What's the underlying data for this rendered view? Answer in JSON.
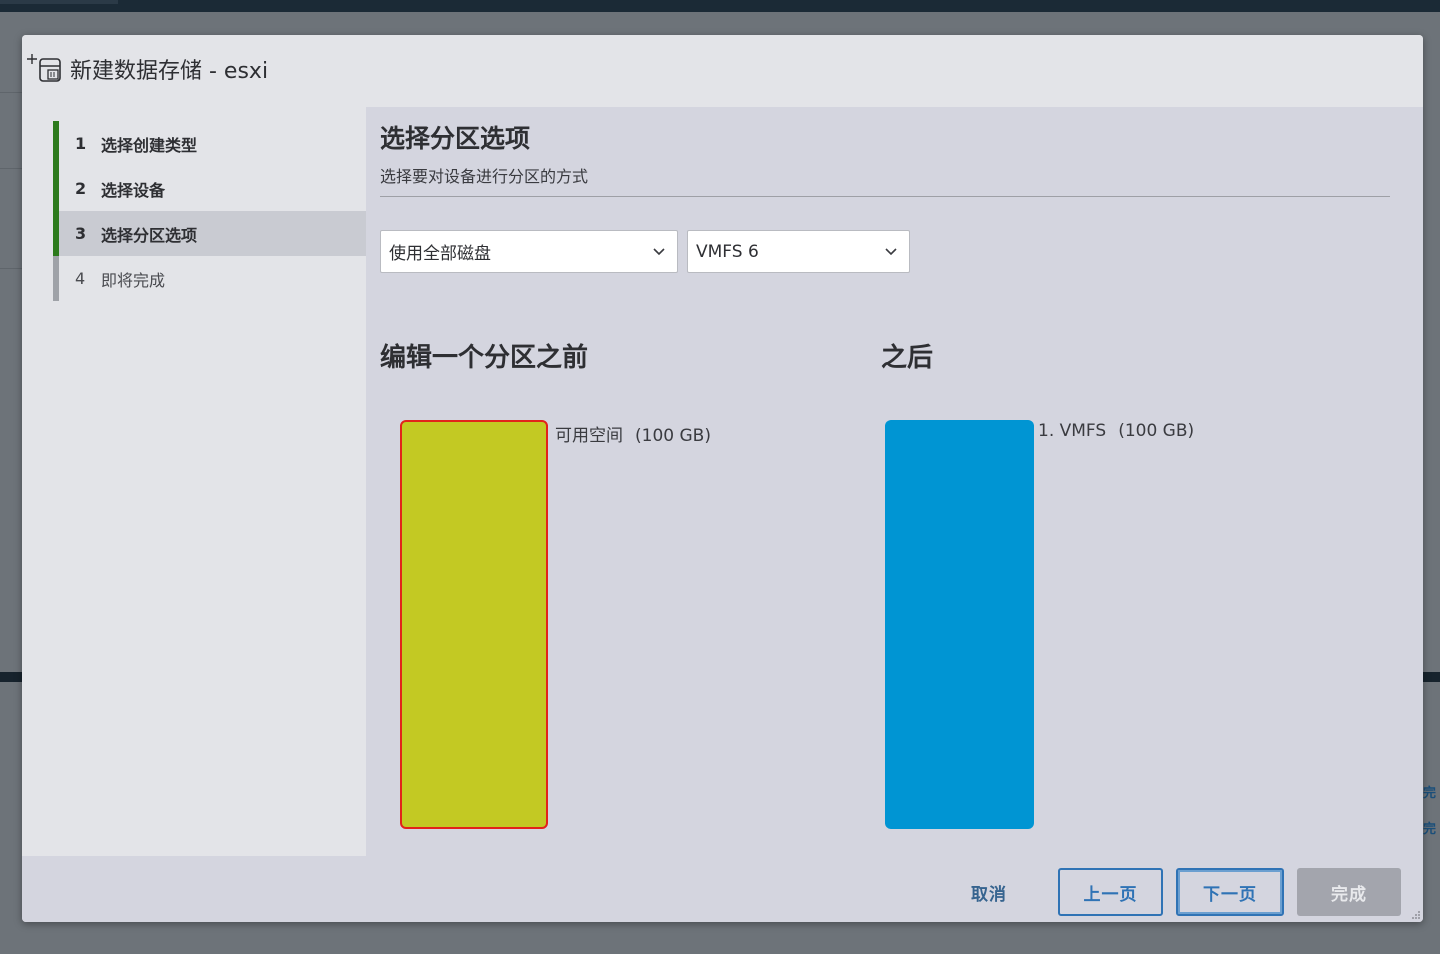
{
  "dialog": {
    "title": "新建数据存储 - esxi"
  },
  "wizard_steps": [
    {
      "number": "1",
      "label": "选择创建类型",
      "state": "completed"
    },
    {
      "number": "2",
      "label": "选择设备",
      "state": "completed"
    },
    {
      "number": "3",
      "label": "选择分区选项",
      "state": "active"
    },
    {
      "number": "4",
      "label": "即将完成",
      "state": "pending"
    }
  ],
  "main": {
    "title": "选择分区选项",
    "subtitle": "选择要对设备进行分区的方式",
    "partition_scheme": {
      "value": "使用全部磁盘"
    },
    "vmfs_version": {
      "value": "VMFS 6"
    },
    "before": {
      "title": "编辑一个分区之前",
      "partition_name": "可用空间",
      "partition_size": "(100 GB)",
      "color": "#c3c923"
    },
    "after": {
      "title": "之后",
      "partition_name": "1. VMFS",
      "partition_size": "(100 GB)",
      "color": "#0095d3"
    }
  },
  "footer": {
    "cancel": "取消",
    "prev": "上一页",
    "next": "下一页",
    "finish": "完成"
  },
  "background": {
    "right_edge_text_1": "完",
    "right_edge_text_2": "完"
  }
}
